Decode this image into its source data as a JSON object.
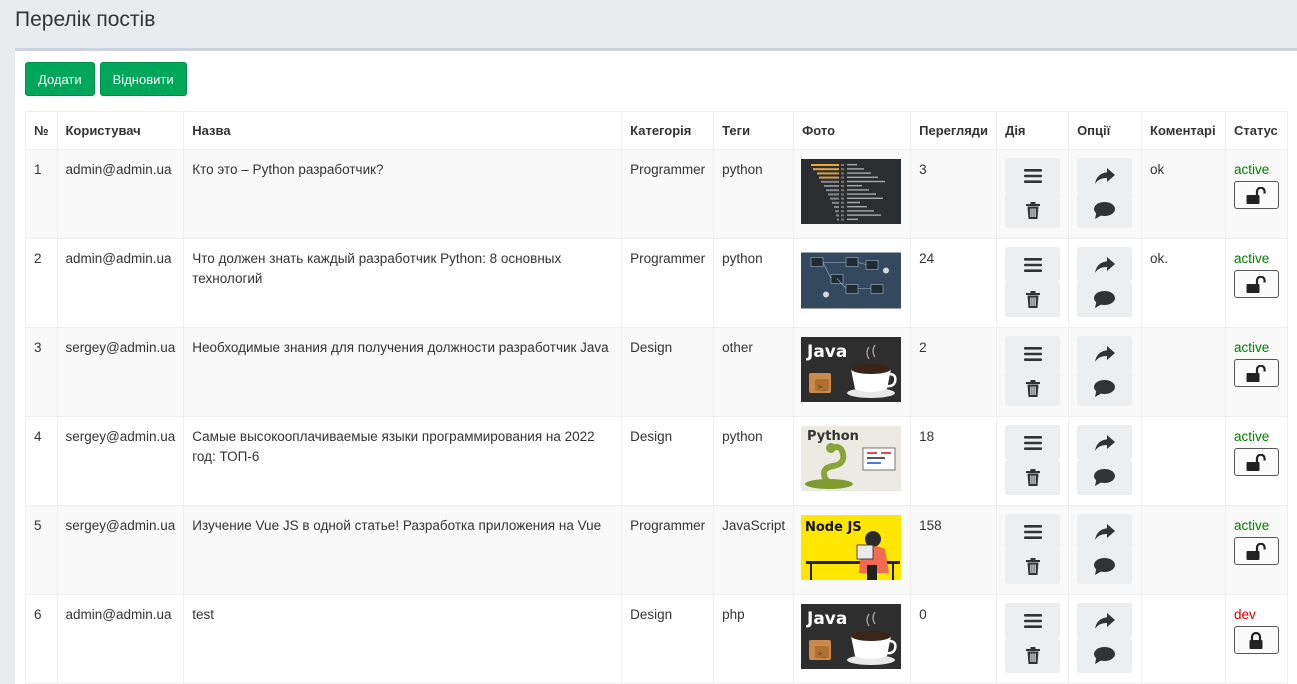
{
  "page": {
    "title": "Перелік постів"
  },
  "toolbar": {
    "add_label": "Додати",
    "restore_label": "Відновити"
  },
  "columns": [
    "№",
    "Користувач",
    "Назва",
    "Категорія",
    "Теги",
    "Фото",
    "Перегляди",
    "Дія",
    "Опції",
    "Коментарі",
    "Статус"
  ],
  "rows": [
    {
      "num": "1",
      "user": "admin@admin.ua",
      "title": "Кто это – Python разработчик?",
      "category": "Programmer",
      "tags": "python",
      "photo": "dark-chart-thumbnail",
      "views": "3",
      "comment": "ok",
      "status": "active",
      "lock": "unlocked"
    },
    {
      "num": "2",
      "user": "admin@admin.ua",
      "title": "Что должен знать каждый разработчик Python: 8 основных технологий",
      "category": "Programmer",
      "tags": "python",
      "photo": "diagram-thumbnail",
      "views": "24",
      "comment": "ok.",
      "status": "active",
      "lock": "unlocked"
    },
    {
      "num": "3",
      "user": "sergey@admin.ua",
      "title": "Необходимые знания для получения должности разработчик Java",
      "category": "Design",
      "tags": "other",
      "photo": "java-thumbnail",
      "views": "2",
      "comment": "",
      "status": "active",
      "lock": "unlocked"
    },
    {
      "num": "4",
      "user": "sergey@admin.ua",
      "title": "Самые высокооплачиваемые языки программирования на 2022 год: ТОП-6",
      "category": "Design",
      "tags": "python",
      "photo": "python-snake-thumbnail",
      "views": "18",
      "comment": "",
      "status": "active",
      "lock": "unlocked"
    },
    {
      "num": "5",
      "user": "sergey@admin.ua",
      "title": "Изучение Vue JS в одной статье! Разработка приложения на Vue",
      "category": "Programmer",
      "tags": "JavaScript",
      "photo": "nodejs-thumbnail",
      "views": "158",
      "comment": "",
      "status": "active",
      "lock": "unlocked"
    },
    {
      "num": "6",
      "user": "admin@admin.ua",
      "title": "test",
      "category": "Design",
      "tags": "php",
      "photo": "java-thumbnail",
      "views": "0",
      "comment": "",
      "status": "dev",
      "lock": "locked"
    }
  ],
  "thumb_text": {
    "java": "Java",
    "python": "Python",
    "node": "Node JS"
  },
  "colors": {
    "primary_button": "#00a65a",
    "status_active": "#008000",
    "status_dev": "#dd0000"
  }
}
